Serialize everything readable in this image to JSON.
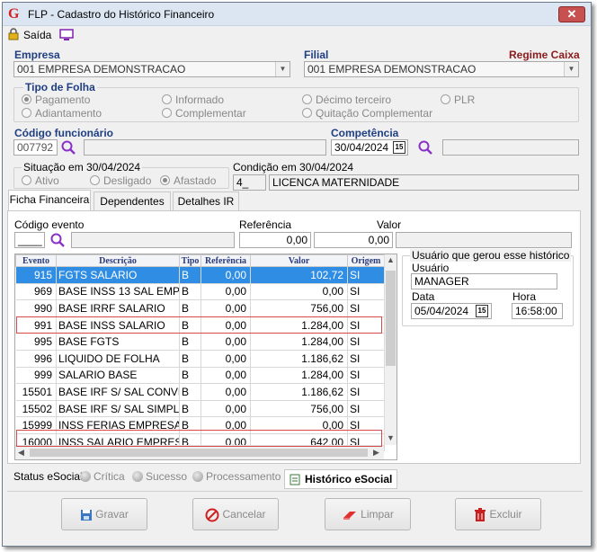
{
  "window": {
    "title": "FLP - Cadastro do Histórico Financeiro",
    "close": "✕"
  },
  "toolbar": {
    "exit_label": "Saída"
  },
  "empresa": {
    "label": "Empresa",
    "value": "001 EMPRESA DEMONSTRACAO"
  },
  "filial": {
    "label": "Filial",
    "value": "001 EMPRESA DEMONSTRACAO",
    "regime": "Regime Caixa"
  },
  "tipo_folha": {
    "label": "Tipo de Folha",
    "options": [
      "Pagamento",
      "Adiantamento",
      "Informado",
      "Complementar",
      "Décimo terceiro",
      "Quitação Complementar",
      "PLR"
    ],
    "selected": "Pagamento"
  },
  "funcionario": {
    "label": "Código funcionário",
    "code": "007792",
    "name": ""
  },
  "competencia": {
    "label": "Competência",
    "value": "30/04/2024",
    "cal_icon": "15",
    "extra": ""
  },
  "situacao": {
    "label": "Situação em  30/04/2024",
    "options": [
      "Ativo",
      "Desligado",
      "Afastado"
    ],
    "selected": "Afastado"
  },
  "condicao": {
    "label": "Condição em 30/04/2024",
    "code": "4_",
    "value": "LICENCA MATERNIDADE"
  },
  "tabs": [
    "Ficha Financeira",
    "Dependentes",
    "Detalhes IR"
  ],
  "evento_form": {
    "codigo_label": "Código evento",
    "codigo_value": "____",
    "referencia_label": "Referência",
    "referencia_value": "0,00",
    "valor_label": "Valor",
    "valor_value": "0,00"
  },
  "table": {
    "headers": [
      "Evento",
      "Descrição",
      "Tipo",
      "Referência",
      "Valor",
      "Origem"
    ],
    "rows": [
      {
        "evento": "915",
        "descricao": "FGTS SALARIO",
        "tipo": "B",
        "referencia": "0,00",
        "valor": "102,72",
        "origem": "SI"
      },
      {
        "evento": "969",
        "descricao": "BASE INSS 13 SAL EMP",
        "tipo": "B",
        "referencia": "0,00",
        "valor": "0,00",
        "origem": "SI"
      },
      {
        "evento": "990",
        "descricao": "BASE IRRF SALARIO",
        "tipo": "B",
        "referencia": "0,00",
        "valor": "756,00",
        "origem": "SI"
      },
      {
        "evento": "991",
        "descricao": "BASE INSS SALARIO",
        "tipo": "B",
        "referencia": "0,00",
        "valor": "1.284,00",
        "origem": "SI"
      },
      {
        "evento": "995",
        "descricao": "BASE FGTS",
        "tipo": "B",
        "referencia": "0,00",
        "valor": "1.284,00",
        "origem": "SI"
      },
      {
        "evento": "996",
        "descricao": "LIQUIDO DE FOLHA",
        "tipo": "B",
        "referencia": "0,00",
        "valor": "1.186,62",
        "origem": "SI"
      },
      {
        "evento": "999",
        "descricao": "SALARIO BASE",
        "tipo": "B",
        "referencia": "0,00",
        "valor": "1.284,00",
        "origem": "SI"
      },
      {
        "evento": "15501",
        "descricao": "BASE IRF S/ SAL CONVEN",
        "tipo": "B",
        "referencia": "0,00",
        "valor": "1.186,62",
        "origem": "SI"
      },
      {
        "evento": "15502",
        "descricao": "BASE IRF S/ SAL SIMPL",
        "tipo": "B",
        "referencia": "0,00",
        "valor": "756,00",
        "origem": "SI"
      },
      {
        "evento": "15999",
        "descricao": "INSS FERIAS EMPRESA",
        "tipo": "B",
        "referencia": "0,00",
        "valor": "0,00",
        "origem": "SI"
      },
      {
        "evento": "16000",
        "descricao": "INSS SALARIO EMPRESA",
        "tipo": "B",
        "referencia": "0,00",
        "valor": "642,00",
        "origem": "SI"
      }
    ]
  },
  "usuario_box": {
    "title": "Usuário que gerou esse histórico",
    "usuario_label": "Usuário",
    "usuario": "MANAGER",
    "data_label": "Data",
    "data": "05/04/2024",
    "hora_label": "Hora",
    "hora": "16:58:00",
    "cal_icon": "15"
  },
  "status": {
    "label": "Status eSocial:",
    "items": [
      "Crítica",
      "Sucesso",
      "Processamento"
    ],
    "historico": "Histórico eSocial"
  },
  "buttons": {
    "gravar": "Gravar",
    "cancelar": "Cancelar",
    "limpar": "Limpar",
    "excluir": "Excluir"
  },
  "colors": {
    "selected_row": "#2f8de4",
    "highlight": "#d54a4a",
    "label_blue": "#1f3f82",
    "label_red": "#8b1a1a"
  }
}
